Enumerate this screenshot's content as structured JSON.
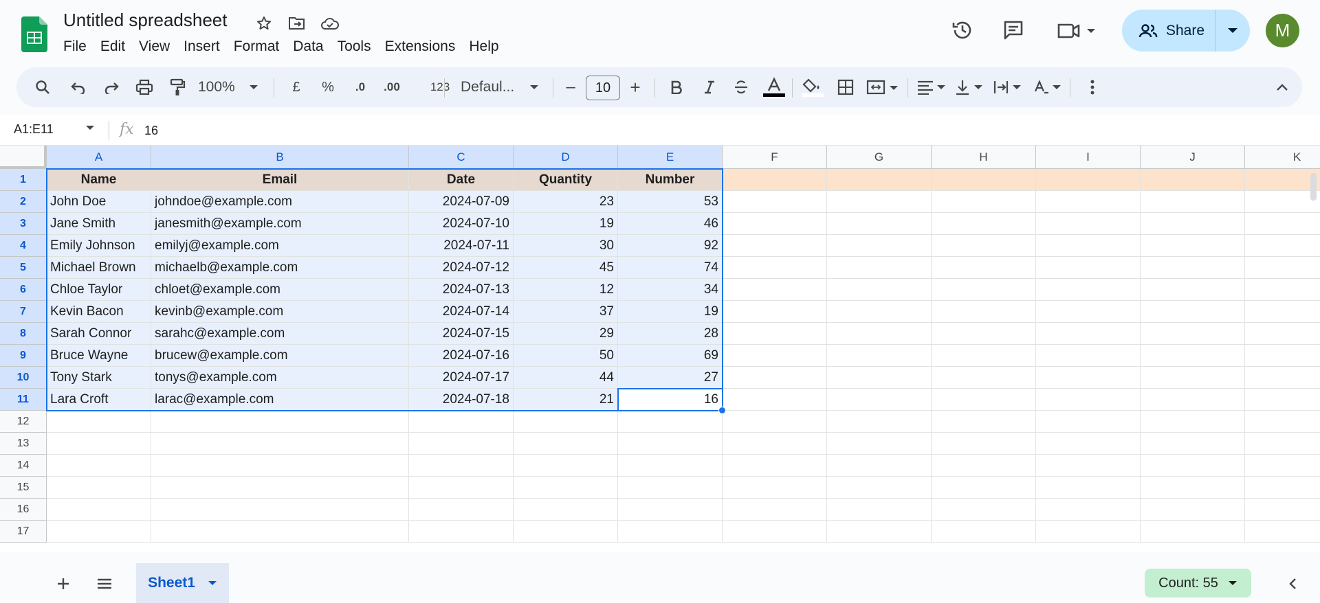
{
  "app": {
    "title": "Untitled spreadsheet",
    "user_initial": "M"
  },
  "menu": [
    "File",
    "Edit",
    "View",
    "Insert",
    "Format",
    "Data",
    "Tools",
    "Extensions",
    "Help"
  ],
  "share": {
    "label": "Share"
  },
  "toolbar": {
    "zoom": "100%",
    "currency": "£",
    "percent": "%",
    "decrease_decimal": ".0",
    "increase_decimal": ".00",
    "number_format": "123",
    "font": "Defaul...",
    "font_size": "10",
    "minus": "–",
    "plus": "+"
  },
  "formula_bar": {
    "name_box": "A1:E11",
    "fx": "fx",
    "value": "16"
  },
  "grid": {
    "columns": [
      "A",
      "B",
      "C",
      "D",
      "E",
      "F",
      "G",
      "H",
      "I",
      "J",
      "K"
    ],
    "row_numbers": [
      "1",
      "2",
      "3",
      "4",
      "5",
      "6",
      "7",
      "8",
      "9",
      "10",
      "11",
      "12",
      "13",
      "14",
      "15",
      "16",
      "17"
    ],
    "header_row": [
      "Name",
      "Email",
      "Date",
      "Quantity",
      "Number"
    ],
    "rows": [
      [
        "John Doe",
        "johndoe@example.com",
        "2024-07-09",
        "23",
        "53"
      ],
      [
        "Jane Smith",
        "janesmith@example.com",
        "2024-07-10",
        "19",
        "46"
      ],
      [
        "Emily Johnson",
        "emilyj@example.com",
        "2024-07-11",
        "30",
        "92"
      ],
      [
        "Michael Brown",
        "michaelb@example.com",
        "2024-07-12",
        "45",
        "74"
      ],
      [
        "Chloe Taylor",
        "chloet@example.com",
        "2024-07-13",
        "12",
        "34"
      ],
      [
        "Kevin Bacon",
        "kevinb@example.com",
        "2024-07-14",
        "37",
        "19"
      ],
      [
        "Sarah Connor",
        "sarahc@example.com",
        "2024-07-15",
        "29",
        "28"
      ],
      [
        "Bruce Wayne",
        "brucew@example.com",
        "2024-07-16",
        "50",
        "69"
      ],
      [
        "Tony Stark",
        "tonys@example.com",
        "2024-07-17",
        "44",
        "27"
      ],
      [
        "Lara Croft",
        "larac@example.com",
        "2024-07-18",
        "21",
        "16"
      ]
    ],
    "selected_columns": [
      "A",
      "B",
      "C",
      "D",
      "E"
    ],
    "selected_row_count": 11,
    "active_cell": "E11"
  },
  "bottom": {
    "sheet_tab": "Sheet1",
    "count_label": "Count: 55"
  },
  "colors": {
    "header_fill": "#e6d9cf",
    "header_empty_fill": "#fde3cc",
    "selection": "#1a73e8",
    "share_bg": "#c2e7ff",
    "avatar_bg": "#5a8a2e",
    "count_bg": "#c4eed0"
  }
}
